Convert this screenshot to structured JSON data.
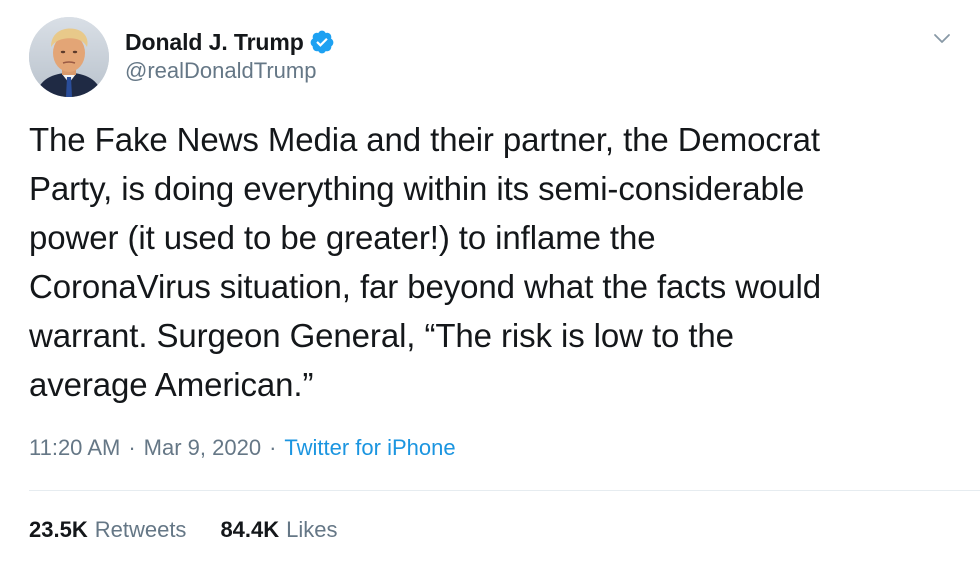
{
  "user": {
    "display_name": "Donald J. Trump",
    "handle": "@realDonaldTrump",
    "verified": true
  },
  "tweet": {
    "text": "The Fake News Media and their partner, the Democrat\nParty, is doing everything within its semi-considerable\npower (it used to be greater!) to inflame the\nCoronaVirus situation, far beyond what the facts would\nwarrant. Surgeon General, “The risk is low to the\naverage American.”",
    "time": "11:20 AM",
    "date": "Mar 9, 2020",
    "separator": "·",
    "source": "Twitter for iPhone"
  },
  "stats": {
    "retweets_count": "23.5K",
    "retweets_label": "Retweets",
    "likes_count": "84.4K",
    "likes_label": "Likes"
  },
  "icons": {
    "verified": "verified-badge-icon",
    "caret": "chevron-down-icon"
  },
  "colors": {
    "text": "#14171a",
    "secondary": "#657786",
    "link": "#1b95e0",
    "verified": "#1da1f2",
    "divider": "#e6ecf0"
  }
}
